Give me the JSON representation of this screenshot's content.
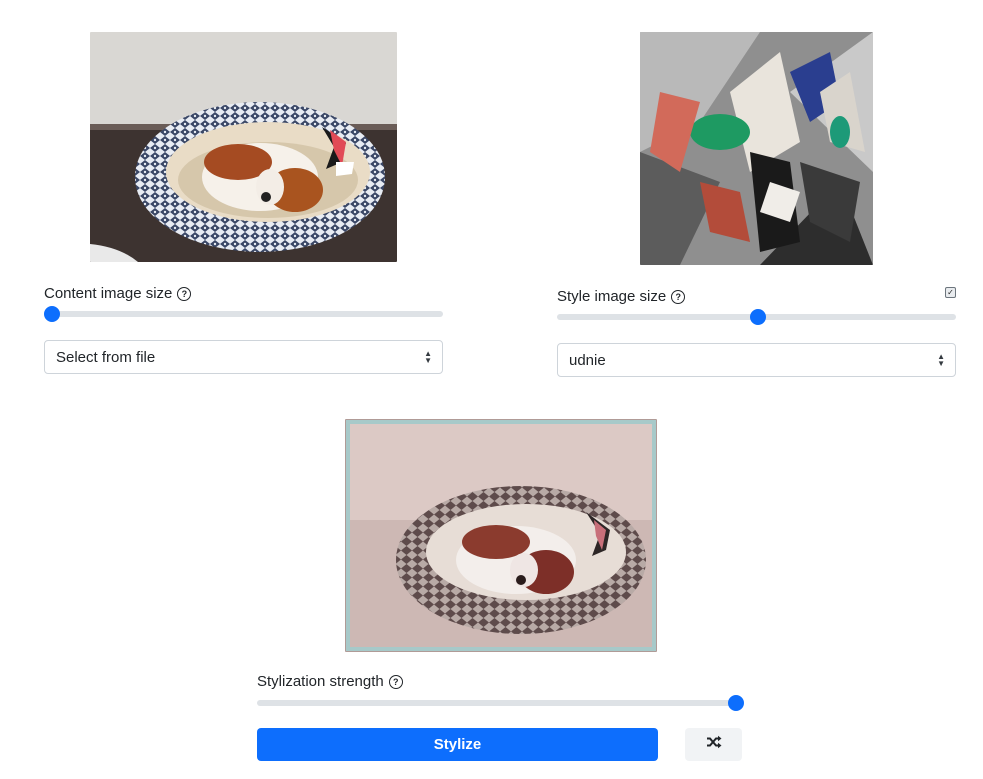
{
  "content": {
    "size_label": "Content image size",
    "size_value": 0.0,
    "source_selected": "Select from file"
  },
  "style": {
    "size_label": "Style image size",
    "size_value": 0.5,
    "source_selected": "udnie",
    "option_checked": true
  },
  "stylization": {
    "strength_label": "Stylization strength",
    "strength_value": 1.0
  },
  "actions": {
    "stylize_label": "Stylize",
    "randomize_icon": "shuffle-icon"
  },
  "colors": {
    "accent": "#0d6efd",
    "track": "#dee2e6"
  }
}
